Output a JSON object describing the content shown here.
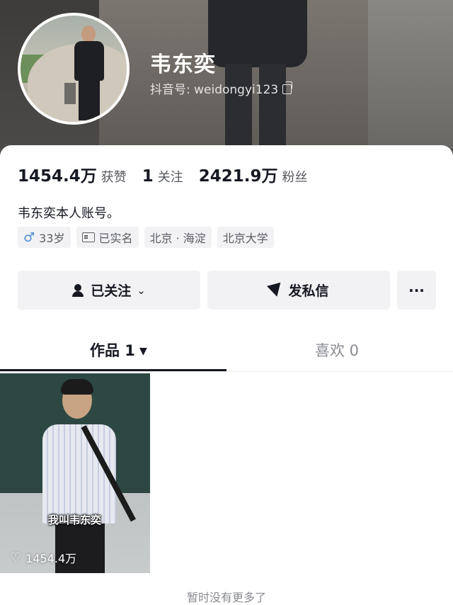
{
  "profile": {
    "name": "韦东奕",
    "id_text": "抖音号: weidongyi123"
  },
  "stats": {
    "likes_value": "1454.4万",
    "likes_label": "获赞",
    "following_value": "1",
    "following_label": "关注",
    "followers_value": "2421.9万",
    "followers_label": "粉丝"
  },
  "bio": "韦东奕本人账号。",
  "tags": {
    "age": "33岁",
    "verified": "已实名",
    "location": "北京 · 海淀",
    "school": "北京大学"
  },
  "actions": {
    "follow_label": "已关注",
    "message_label": "发私信",
    "more_label": "···"
  },
  "tabs": {
    "works_label": "作品 1",
    "likes_label": "喜欢 0"
  },
  "video": {
    "caption": "我叫韦东奕",
    "likes": "1454.4万"
  },
  "footer_note": "暂时没有更多了",
  "icons": {
    "gender": "male-icon",
    "verified": "id-card-icon",
    "copy": "copy-icon",
    "follow": "user-check-icon",
    "message": "send-icon",
    "heart": "heart-icon"
  },
  "colors": {
    "text_primary": "#161823",
    "text_secondary": "#57585e",
    "male_accent": "#4e8fd6",
    "button_bg": "#f2f2f4"
  }
}
